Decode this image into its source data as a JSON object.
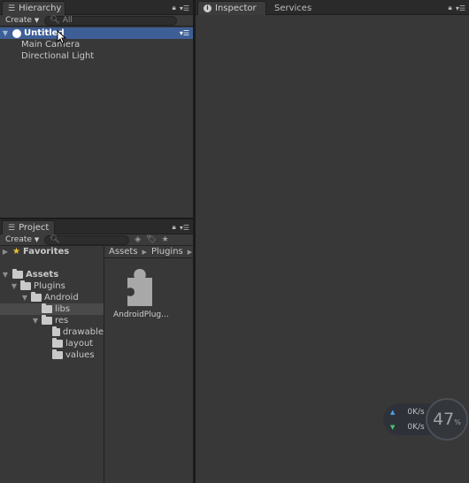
{
  "hierarchy": {
    "tab_label": "Hierarchy",
    "create_label": "Create",
    "search_placeholder": "All",
    "scene_name": "Untitled",
    "items": [
      "Main Camera",
      "Directional Light"
    ]
  },
  "inspector": {
    "tabs": [
      "Inspector",
      "Services"
    ]
  },
  "project": {
    "tab_label": "Project",
    "create_label": "Create",
    "tree": {
      "favorites": "Favorites",
      "assets": "Assets",
      "plugins": "Plugins",
      "android": "Android",
      "libs": "libs",
      "res": "res",
      "drawable": "drawable",
      "layout": "layout",
      "values": "values"
    },
    "breadcrumb": [
      "Assets",
      "Plugins"
    ],
    "asset_name": "AndroidPlug..."
  },
  "network_widget": {
    "upload": "0K/s",
    "download": "0K/s",
    "percent": "47",
    "percent_unit": "%"
  },
  "colors": {
    "selection": "#3e5f96",
    "panel": "#383838"
  }
}
